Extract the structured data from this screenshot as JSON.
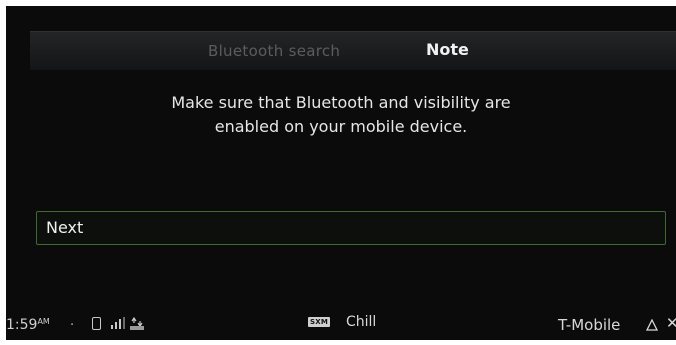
{
  "header": {
    "tabs": [
      {
        "label": "Bluetooth search",
        "active": false
      },
      {
        "label": "Note",
        "active": true
      }
    ]
  },
  "message": {
    "line1": "Make sure that Bluetooth and visibility are",
    "line2": "enabled on your mobile device."
  },
  "actions": {
    "next_label": "Next"
  },
  "status_bar": {
    "time": "1:59",
    "ampm": "AM",
    "separator": ".",
    "radio_source": "SXM",
    "station": "Chill",
    "carrier": "T-Mobile"
  },
  "colors": {
    "background": "#0b0b0c",
    "accent": "#3d6b2e",
    "text": "#e6e6e6"
  }
}
